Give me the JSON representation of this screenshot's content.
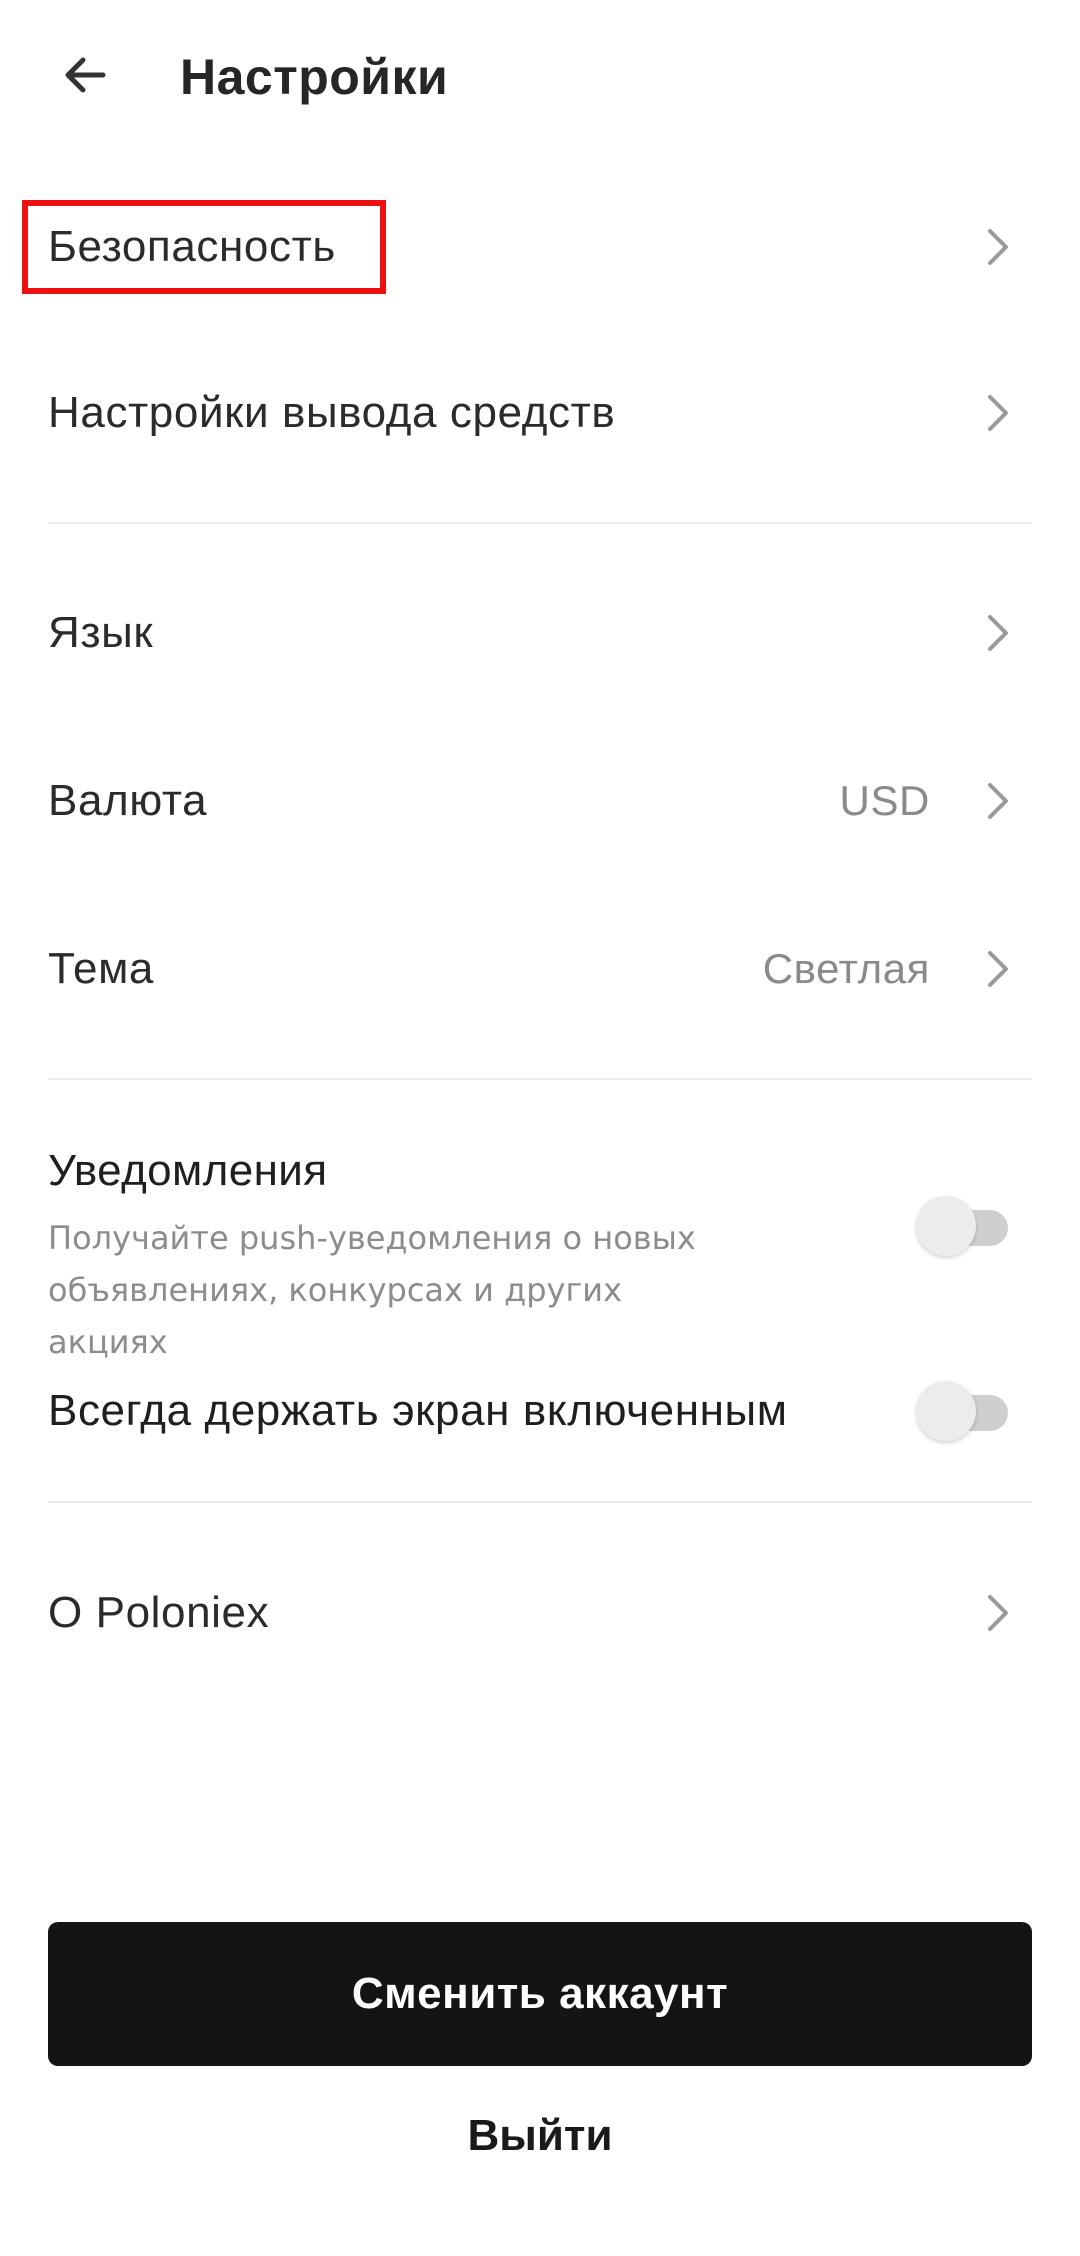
{
  "header": {
    "title": "Настройки"
  },
  "settings": {
    "security": {
      "label": "Безопасность"
    },
    "withdrawal": {
      "label": "Настройки вывода средств"
    },
    "language": {
      "label": "Язык"
    },
    "currency": {
      "label": "Валюта",
      "value": "USD"
    },
    "theme": {
      "label": "Тема",
      "value": "Светлая"
    },
    "notifications": {
      "label": "Уведомления",
      "description": "Получайте push-уведомления о новых объявлениях, конкурсах и других акциях",
      "enabled": false
    },
    "keep_screen_on": {
      "label": "Всегда держать экран включенным",
      "enabled": false
    },
    "about": {
      "label": "О Poloniex"
    }
  },
  "actions": {
    "switch_account": "Сменить аккаунт",
    "logout": "Выйти"
  },
  "icons": {
    "back": "arrow-left-icon",
    "chevron": "chevron-right-icon"
  },
  "colors": {
    "highlight": "#ee1111",
    "primary_button": "#141414"
  }
}
